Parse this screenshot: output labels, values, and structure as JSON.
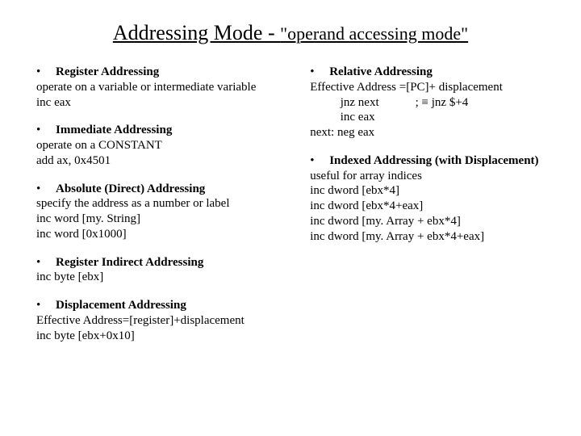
{
  "title": {
    "t1": "Addressing Mode - ",
    "t2": "\"operand accessing mode\""
  },
  "bullet": "•",
  "left": {
    "s1": {
      "h": "Register Addressing",
      "l1": "operate on a variable or intermediate variable",
      "l2": "inc eax"
    },
    "s2": {
      "h": "Immediate Addressing",
      "l1": "operate on a CONSTANT",
      "l2": "add ax, 0x4501"
    },
    "s3": {
      "h": "Absolute (Direct) Addressing",
      "l1": "specify the address as a number or label",
      "l2": "inc word [my. String]",
      "l3": "inc word [0x1000]"
    },
    "s4": {
      "h": "Register Indirect Addressing",
      "l1": "inc byte [ebx]"
    },
    "s5": {
      "h": "Displacement Addressing",
      "l1": "Effective Address=[register]+displacement",
      "l2": "inc byte [ebx+0x10]"
    }
  },
  "right": {
    "s1": {
      "h": "Relative Addressing",
      "l1": "Effective Address =[PC]+ displacement",
      "l2": "jnz next            ; ≡ jnz $+4",
      "l3": "inc eax",
      "l4": "next: neg eax"
    },
    "s2": {
      "h": "Indexed Addressing (with Displacement)",
      "l1": "useful for array indices",
      "l2": "inc dword [ebx*4]",
      "l3": "inc dword [ebx*4+eax]",
      "l4": "inc dword [my. Array + ebx*4]",
      "l5": "inc dword [my. Array + ebx*4+eax]"
    }
  }
}
